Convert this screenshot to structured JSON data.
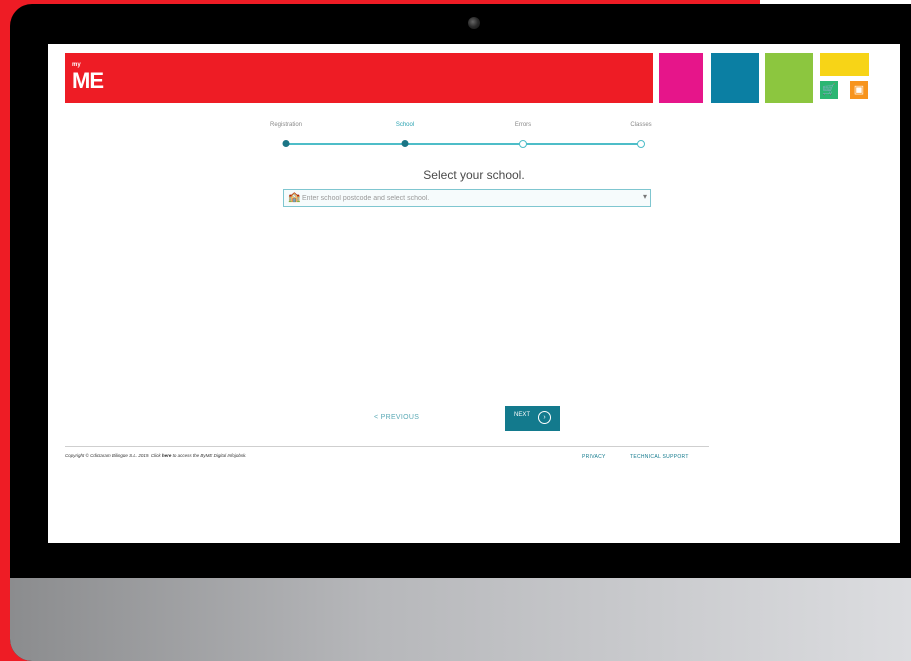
{
  "brand": {
    "logo_text": "ME",
    "logo_sup": "my",
    "colors": {
      "red": "#ee1c25",
      "pink": "#e6158a",
      "teal": "#0b7fa3",
      "green": "#8cc63f",
      "yellow": "#f7d417",
      "accent": "#137a8d"
    }
  },
  "header": {
    "icons": [
      "cart-icon",
      "gift-icon"
    ]
  },
  "steps": [
    {
      "label": "Registration",
      "state": "done"
    },
    {
      "label": "School",
      "state": "active"
    },
    {
      "label": "Errors",
      "state": "pending"
    },
    {
      "label": "Classes",
      "state": "pending"
    }
  ],
  "main": {
    "title": "Select your school.",
    "search_placeholder": "Enter school postcode and select school."
  },
  "nav": {
    "previous": "< PREVIOUS",
    "next": "NEXT"
  },
  "footer": {
    "copyright_pre": "Copyright © Cdictaram Bilingüe S.L. 2019. Click ",
    "copyright_link": "here",
    "copyright_post": " to access the ByME Digital Infojobsk.",
    "privacy": "PRIVACY",
    "support": "TECHNICAL SUPPORT"
  }
}
